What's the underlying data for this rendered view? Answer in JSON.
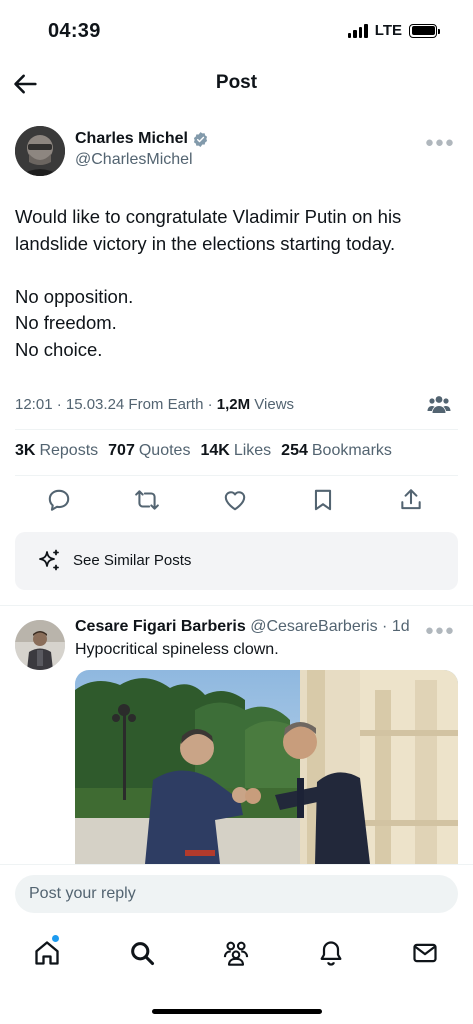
{
  "status_bar": {
    "time": "04:39",
    "network": "LTE"
  },
  "header": {
    "title": "Post",
    "back_icon": "arrow-left-icon"
  },
  "post": {
    "author_name": "Charles Michel",
    "author_handle": "@CharlesMichel",
    "verified_color": "#829aab",
    "lines": [
      "Would like to congratulate Vladimir Putin on his",
      "landslide victory in the elections starting today.",
      "",
      "No opposition.",
      "No freedom.",
      "No choice."
    ],
    "meta": {
      "time_date": "12:01 · 15.03.24 From Earth · ",
      "views_count": "1,2M",
      "views_label": " Views"
    },
    "stats": [
      {
        "count": "3K",
        "label": "Reposts"
      },
      {
        "count": "707",
        "label": "Quotes"
      },
      {
        "count": "14K",
        "label": "Likes"
      },
      {
        "count": "254",
        "label": "Bookmarks"
      }
    ],
    "actions": [
      "reply-icon",
      "repost-icon",
      "like-icon",
      "bookmark-icon",
      "share-icon"
    ]
  },
  "similar_posts": {
    "label": "See Similar Posts",
    "icon": "sparkle-icon"
  },
  "reply": {
    "name": "Cesare Figari Barberis",
    "handle": "@CesareBarberis",
    "time": " · 1d",
    "text": "Hypocritical spineless clown."
  },
  "compose": {
    "placeholder": "Post your reply"
  },
  "tabs": [
    "home-icon",
    "search-icon",
    "communities-icon",
    "notifications-icon",
    "messages-icon"
  ],
  "colors": {
    "accent": "#1d9bf0",
    "text": "#0f1419",
    "secondary": "#536471"
  }
}
